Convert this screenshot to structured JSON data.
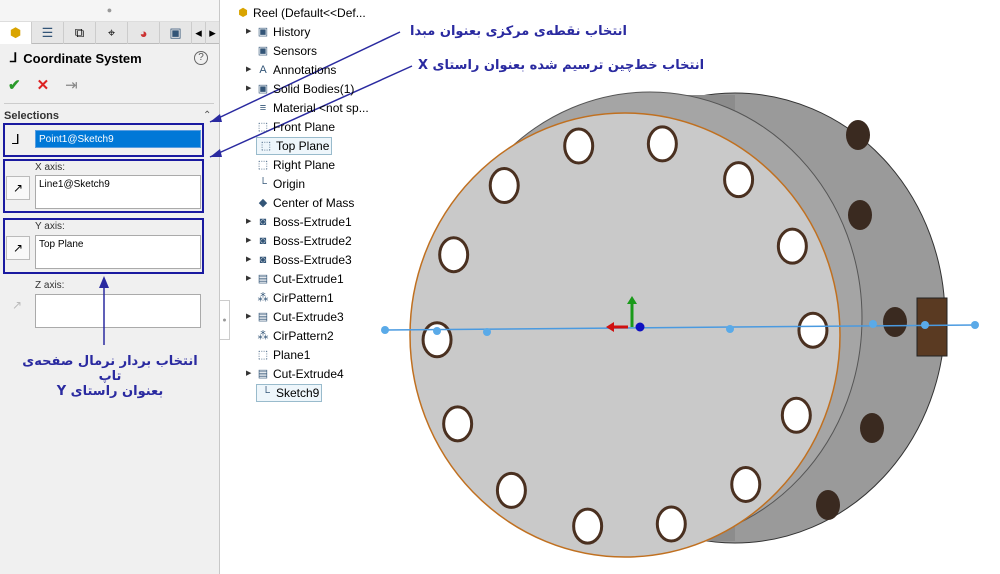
{
  "panel": {
    "tabs": [
      "part-icon",
      "property-icon",
      "config-icon",
      "target-icon",
      "appearance-icon",
      "display-icon"
    ],
    "title": "Coordinate System",
    "help": "?",
    "ok": "✔",
    "cancel": "✕",
    "pin": "⇥",
    "section": "Selections",
    "origin_value": "Point1@Sketch9",
    "x_label": "X axis:",
    "x_value": "Line1@Sketch9",
    "y_label": "Y axis:",
    "y_value": "Top Plane",
    "z_label": "Z axis:",
    "z_value": ""
  },
  "tree": {
    "root": "Reel  (Default<<Def...",
    "items": [
      {
        "label": "History",
        "expand": true,
        "icon": "folder-icon"
      },
      {
        "label": "Sensors",
        "expand": false,
        "icon": "folder-icon"
      },
      {
        "label": "Annotations",
        "expand": true,
        "icon": "annotation-icon"
      },
      {
        "label": "Solid Bodies(1)",
        "expand": true,
        "icon": "folder-icon"
      },
      {
        "label": "Material <not sp...",
        "expand": false,
        "icon": "material-icon"
      },
      {
        "label": "Front Plane",
        "expand": false,
        "icon": "plane-icon"
      },
      {
        "label": "Top Plane",
        "expand": false,
        "icon": "plane-icon",
        "selected": true
      },
      {
        "label": "Right Plane",
        "expand": false,
        "icon": "plane-icon"
      },
      {
        "label": "Origin",
        "expand": false,
        "icon": "origin-icon"
      },
      {
        "label": "Center of Mass",
        "expand": false,
        "icon": "center-of-mass-icon"
      },
      {
        "label": "Boss-Extrude1",
        "expand": true,
        "icon": "extrude-icon"
      },
      {
        "label": "Boss-Extrude2",
        "expand": true,
        "icon": "extrude-icon"
      },
      {
        "label": "Boss-Extrude3",
        "expand": true,
        "icon": "extrude-icon"
      },
      {
        "label": "Cut-Extrude1",
        "expand": true,
        "icon": "cut-icon"
      },
      {
        "label": "CirPattern1",
        "expand": false,
        "icon": "pattern-icon"
      },
      {
        "label": "Cut-Extrude3",
        "expand": true,
        "icon": "cut-icon"
      },
      {
        "label": "CirPattern2",
        "expand": false,
        "icon": "pattern-icon"
      },
      {
        "label": "Plane1",
        "expand": false,
        "icon": "plane-icon"
      },
      {
        "label": "Cut-Extrude4",
        "expand": true,
        "icon": "cut-icon"
      },
      {
        "label": "Sketch9",
        "expand": false,
        "icon": "sketch-icon",
        "selected": true
      }
    ]
  },
  "notes": {
    "origin": "انتخاب نقطه‌ی مرکزی بعنوان مبدا",
    "xaxis": "انتخاب خط‌چین ترسیم شده بعنوان راستای X",
    "yaxis1": "انتخاب بردار نرمال صفحه‌ی تاپ",
    "yaxis2": "بعنوان راستای Y"
  },
  "colors": {
    "annotation": "#2a2aa0",
    "part": "#c8c8c8",
    "selection": "#0078d7"
  }
}
